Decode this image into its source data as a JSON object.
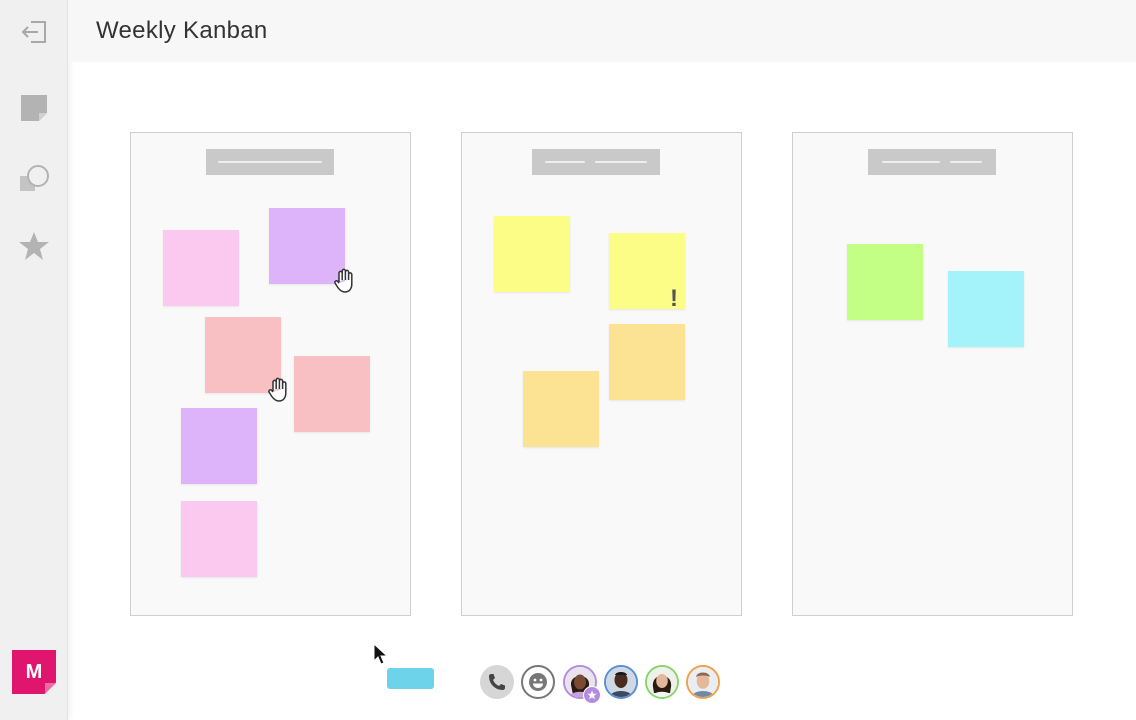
{
  "app": {
    "title": "Weekly Kanban",
    "logo_letter": "M"
  },
  "sidebar": {
    "icons": [
      "exit-icon",
      "sticky-note-icon",
      "shapes-icon",
      "star-icon"
    ]
  },
  "columns": [
    {
      "name": "column-1",
      "notes": [
        {
          "color": "#fbc9ef"
        },
        {
          "color": "#ddb3fa"
        },
        {
          "color": "#f9c0c4"
        },
        {
          "color": "#f9c0c4"
        },
        {
          "color": "#ddb3fa"
        },
        {
          "color": "#fbc9ef"
        }
      ]
    },
    {
      "name": "column-2",
      "notes": [
        {
          "color": "#fbfd87"
        },
        {
          "color": "#fbfd87"
        },
        {
          "color": "#fce394"
        },
        {
          "color": "#fce394"
        }
      ]
    },
    {
      "name": "column-3",
      "notes": [
        {
          "color": "#c4ff85"
        },
        {
          "color": "#a4f2fa"
        }
      ]
    }
  ],
  "indicators": {
    "alert_mark": "!"
  },
  "toolbar": {
    "buttons": [
      "phone-icon",
      "emoji-icon"
    ],
    "collaborators": 4
  },
  "colors": {
    "accent": "#e0156e",
    "chip": "#6dd3ea"
  }
}
